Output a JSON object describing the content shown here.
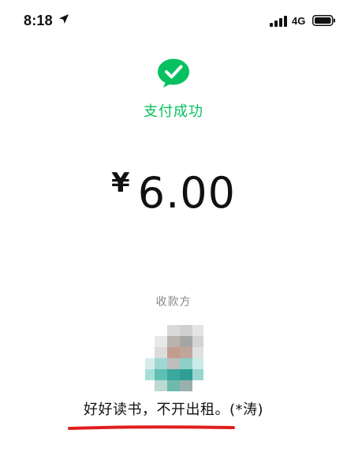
{
  "status_bar": {
    "time": "8:18",
    "network": "4G"
  },
  "payment": {
    "status_text": "支付成功",
    "currency_symbol": "¥",
    "amount": "6.00"
  },
  "payee": {
    "label": "收款方",
    "name": "好好读书，不开出租。(*涛)"
  },
  "colors": {
    "success_green": "#07C160",
    "underline_red": "#E01E1E"
  },
  "icons": {
    "status": [
      "location-arrow-icon",
      "signal-bars-icon",
      "battery-icon"
    ],
    "payment": "wechat-pay-success-icon"
  }
}
